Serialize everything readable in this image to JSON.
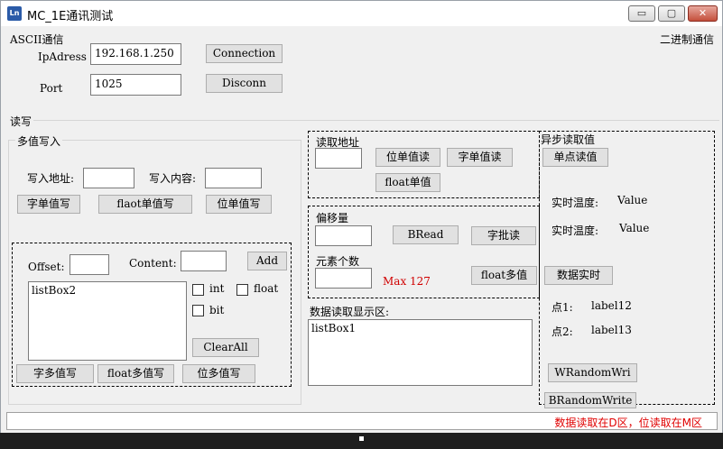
{
  "window": {
    "title": "MC_1E通讯测试",
    "icon": "app-icon",
    "controls": {
      "minimize": "▭",
      "maximize": "▢",
      "close": "✕"
    }
  },
  "header": {
    "ascii_label": "ASCII通信",
    "binary_label": "二进制通信",
    "ip_label": "IpAdress",
    "ip_value": "192.168.1.250",
    "port_label": "Port",
    "port_value": "1025",
    "connect_btn": "Connection",
    "disconnect_btn": "Disconn"
  },
  "rw_label": "读写",
  "multi_write": {
    "title": "多值写入",
    "addr_label": "写入地址:",
    "addr_value": "",
    "content_label": "写入内容:",
    "content_value": "",
    "buttons": [
      "字单值写",
      "flaot单值写",
      "位单值写"
    ],
    "offset_label": "Offset:",
    "offset_value": "",
    "content2_label": "Content:",
    "content2_value": "",
    "add_btn": "Add",
    "listbox_name": "listBox2",
    "checkboxes": [
      "int",
      "float",
      "bit"
    ],
    "clearall_btn": "ClearAll",
    "bottom_buttons": [
      "字多值写",
      "float多值写",
      "位多值写"
    ]
  },
  "read_panel": {
    "addr_label": "读取地址",
    "addr_value": "",
    "bit_read_btn": "位单值读",
    "word_read_btn": "字单值读",
    "float_read_btn": "float单值"
  },
  "batch_panel": {
    "offset_label": "偏移量",
    "offset_value": "",
    "bread_btn": "BRead",
    "word_batch_btn": "字批读",
    "count_label": "元素个数",
    "count_value": "",
    "max_text": "Max 127",
    "float_multi_btn": "float多值"
  },
  "display": {
    "label": "数据读取显示区:",
    "listbox_name": "listBox1"
  },
  "async_panel": {
    "title": "异步读取值",
    "single_read_btn": "单点读值",
    "temp1_label": "实时温度:",
    "temp1_value": "Value",
    "temp2_label": "实时温度:",
    "temp2_value": "Value",
    "realtime_btn": "数据实时",
    "point1_label": "点1:",
    "point1_value": "label12",
    "point2_label": "点2:",
    "point2_value": "label13",
    "wrandom_btn": "WRandomWri",
    "brandom_btn": "BRandomWrite"
  },
  "status": {
    "text": "数据读取在D区，位读取在M区"
  },
  "colors": {
    "status_text": "#e00000",
    "max_text": "#d00000",
    "window_bg": "#f0f0f0"
  }
}
